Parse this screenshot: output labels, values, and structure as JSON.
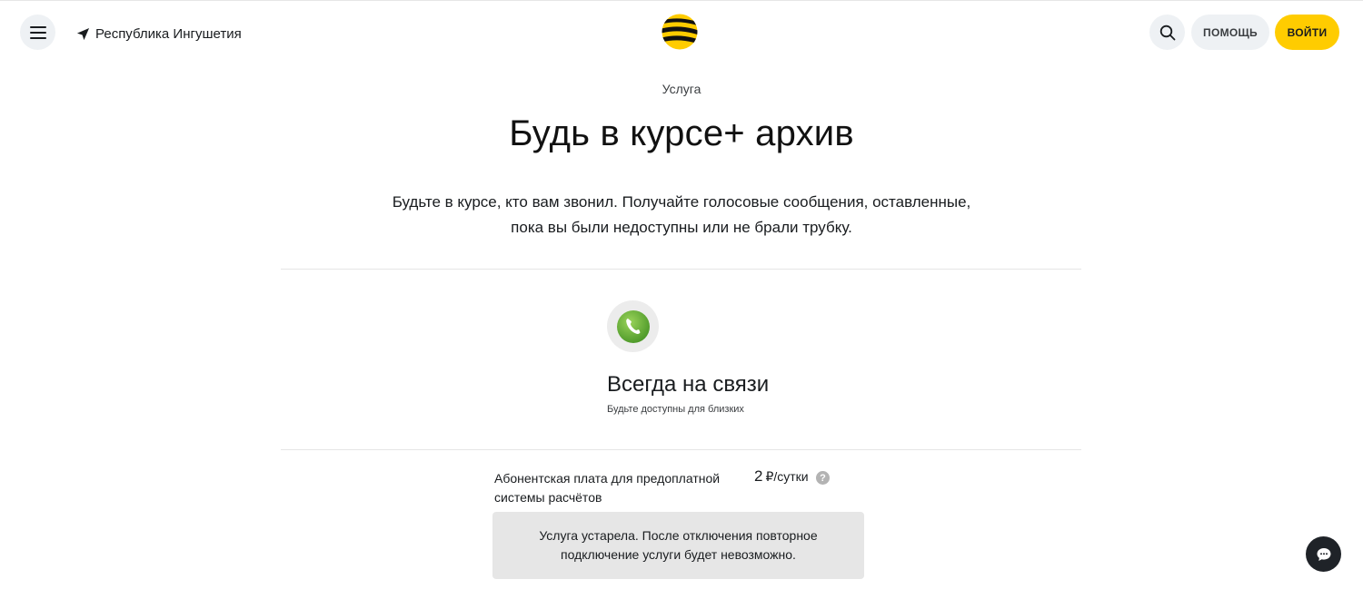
{
  "header": {
    "region": "Республика Ингушетия",
    "help_label": "ПОМОЩЬ",
    "login_label": "ВОЙТИ",
    "icons": [
      "menu-icon",
      "location-arrow-icon",
      "beeline-logo",
      "search-icon"
    ]
  },
  "hero": {
    "eyebrow": "Услуга",
    "title": "Будь в курсе+ архив",
    "description_line1": "Будьте в курсе, кто вам звонил. Получайте голосовые сообщения, оставленные,",
    "description_line2": "пока вы были недоступны или не брали трубку."
  },
  "feature": {
    "icon": "phone-icon",
    "title": "Всегда на связи",
    "subtitle": "Будьте доступны для близких"
  },
  "fee": {
    "label_line1": "Абонентская плата для предоплатной",
    "label_line2": "системы расчётов",
    "amount": "2",
    "unit": "₽/сутки",
    "help_glyph": "?"
  },
  "notice": {
    "line1": "Услуга устарела. После отключения повторное",
    "line2": "подключение услуги будет невозможно."
  },
  "chat": {
    "icon": "chat-icon"
  },
  "colors": {
    "accent": "#ffcc00",
    "button_bg": "#eef1f4",
    "notice_bg": "#e6e6e6",
    "chat_bg": "#1f2328",
    "phone_green": "#6db33f"
  }
}
